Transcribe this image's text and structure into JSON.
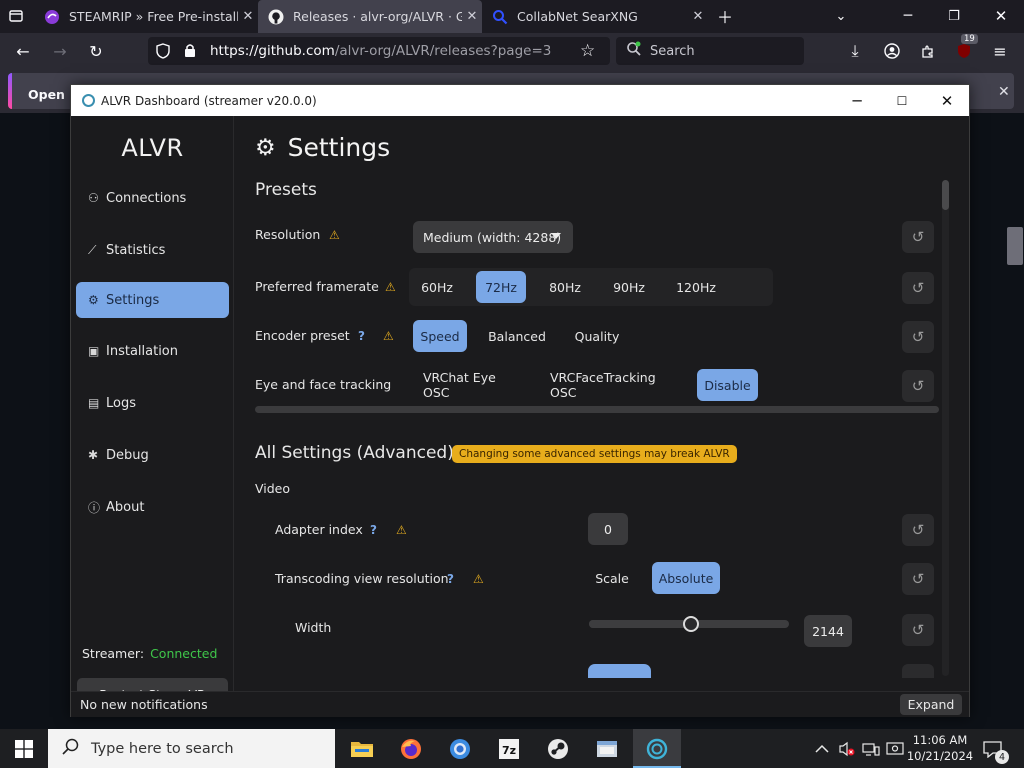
{
  "browser": {
    "tabs": [
      {
        "title": "STEAMRIP » Free Pre-installed St",
        "icon": "steamrip-icon"
      },
      {
        "title": "Releases · alvr-org/ALVR · GitHu",
        "icon": "github-icon"
      },
      {
        "title": "CollabNet SearXNG",
        "icon": "searxng-icon"
      }
    ],
    "url_host": "https://github.com",
    "url_path": "/alvr-org/ALVR/releases?page=3",
    "search_placeholder": "Search",
    "extensions_badge": "19",
    "notification_text": "Open Fir",
    "accent": "#9059ff"
  },
  "window": {
    "title": "ALVR Dashboard (streamer v20.0.0)"
  },
  "sidebar": {
    "brand": "ALVR",
    "items": [
      {
        "label": "Connections",
        "icon": "headset-icon",
        "glyph": "⚇"
      },
      {
        "label": "Statistics",
        "icon": "chart-icon",
        "glyph": "⟋"
      },
      {
        "label": "Settings",
        "icon": "gear-icon",
        "glyph": "⚙"
      },
      {
        "label": "Installation",
        "icon": "installation-icon",
        "glyph": "▣"
      },
      {
        "label": "Logs",
        "icon": "logs-icon",
        "glyph": "▤"
      },
      {
        "label": "Debug",
        "icon": "bug-icon",
        "glyph": "✱"
      },
      {
        "label": "About",
        "icon": "info-icon",
        "glyph": "ⓘ"
      }
    ],
    "streamer_label": "Streamer:",
    "streamer_status": "Connected",
    "restart_label": "Restart SteamVR",
    "active_color": "#7aa7e6",
    "connected_color": "#3fc64a"
  },
  "settings": {
    "title": "Settings",
    "presets_heading": "Presets",
    "resolution": {
      "label": "Resolution",
      "value": "Medium (width: 4288)"
    },
    "framerate": {
      "label": "Preferred framerate",
      "options": [
        "60Hz",
        "72Hz",
        "80Hz",
        "90Hz",
        "120Hz"
      ],
      "selected": "72Hz"
    },
    "encoder": {
      "label": "Encoder preset",
      "options": [
        "Speed",
        "Balanced",
        "Quality"
      ],
      "selected": "Speed"
    },
    "tracking": {
      "label": "Eye and face tracking",
      "options": [
        "VRChat Eye OSC",
        "VRCFaceTracking OSC",
        "Disable"
      ],
      "selected": "Disable"
    },
    "advanced_heading": "All Settings (Advanced)",
    "advanced_warning": "Changing some advanced settings may break ALVR",
    "video_heading": "Video",
    "adapter_index": {
      "label": "Adapter index",
      "value": "0"
    },
    "transcoding": {
      "label": "Transcoding view resolution",
      "options": [
        "Scale",
        "Absolute"
      ],
      "selected": "Absolute"
    },
    "width": {
      "label": "Width",
      "value": "2144",
      "slider_fraction": 0.51
    },
    "help_glyph": "?",
    "warn_glyph": "⚠",
    "reset_glyph": "↺"
  },
  "statusbar": {
    "notification": "No new notifications",
    "expand_label": "Expand"
  },
  "taskbar": {
    "search_placeholder": "Type here to search",
    "time": "11:06 AM",
    "date": "10/21/2024",
    "notification_count": "4"
  }
}
